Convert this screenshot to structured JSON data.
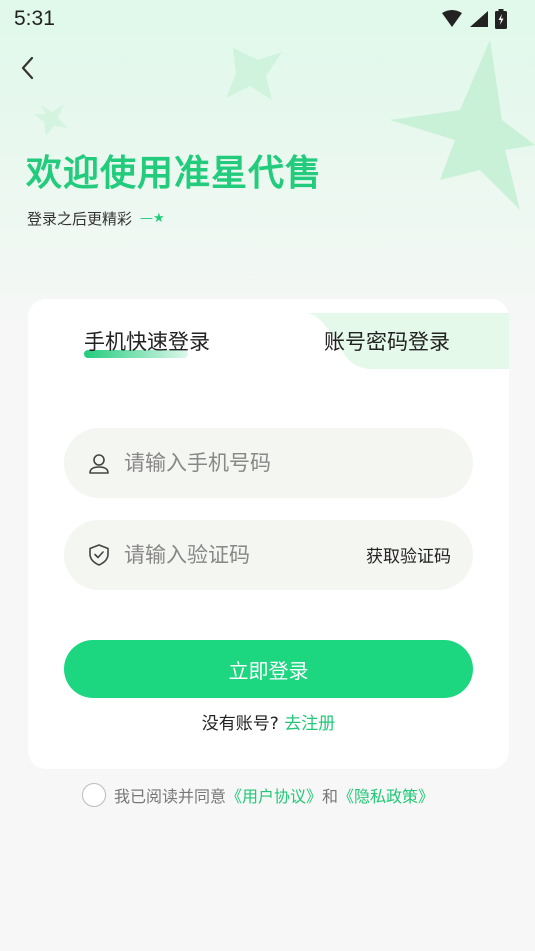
{
  "status_bar": {
    "time": "5:31"
  },
  "nav": {
    "back_icon": "chevron-left-icon"
  },
  "hero": {
    "title": "欢迎使用准星代售",
    "subtitle": "登录之后更精彩",
    "subtitle_deco": "—★"
  },
  "tabs": [
    {
      "label": "手机快速登录",
      "active": true
    },
    {
      "label": "账号密码登录",
      "active": false
    }
  ],
  "form": {
    "phone_placeholder": "请输入手机号码",
    "code_placeholder": "请输入验证码",
    "get_code_label": "获取验证码",
    "login_label": "立即登录",
    "no_account_text": "没有账号?",
    "register_link": "去注册"
  },
  "agreement": {
    "prefix": "我已阅读并同意",
    "user_agreement": "《用户协议》",
    "and": "和",
    "privacy_policy": "《隐私政策》"
  },
  "colors": {
    "accent": "#22cc7c",
    "button": "#1dd680",
    "background": "#f6f7f6"
  }
}
